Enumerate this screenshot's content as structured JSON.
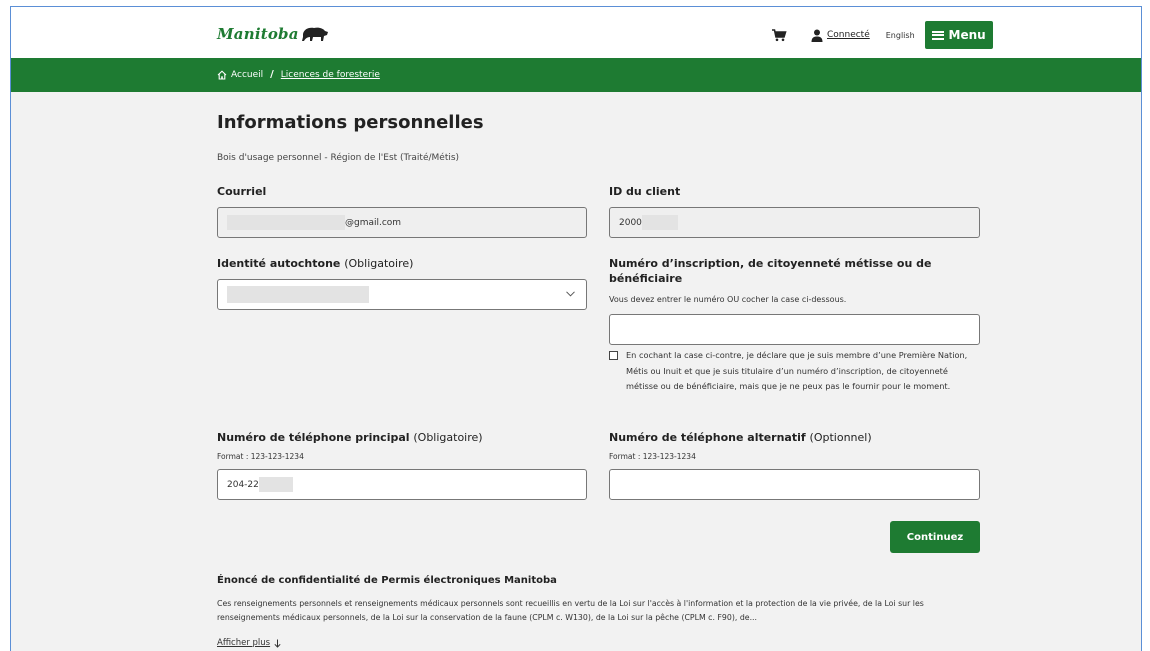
{
  "header": {
    "logo_text": "Manitoba",
    "connected_label": "Connecté",
    "language_label": "English",
    "menu_label": "Menu"
  },
  "breadcrumb": {
    "home_label": "Accueil",
    "separator": "/",
    "current_label": "Licences de foresterie"
  },
  "page": {
    "title": "Informations personnelles",
    "subtitle": "Bois d'usage personnel - Région de l'Est (Traité/Métis)"
  },
  "form": {
    "email": {
      "label": "Courriel",
      "value_suffix": "@gmail.com"
    },
    "client_id": {
      "label": "ID du client",
      "value_prefix": "2000"
    },
    "indigenous_identity": {
      "label": "Identité autochtone",
      "qualifier": "(Obligatoire)"
    },
    "registration_number": {
      "label": "Numéro d’inscription, de citoyenneté métisse ou de bénéficiaire",
      "hint": "Vous devez entrer le numéro OU cocher la case ci-dessous.",
      "value": ""
    },
    "declaration_checkbox": {
      "checked": false,
      "text": "En cochant la case ci-contre, je déclare que je suis membre d’une Première Nation, Métis ou Inuit et que je suis titulaire d’un numéro d’inscription, de citoyenneté métisse ou de bénéficiaire, mais que je ne peux pas le fournir pour le moment."
    },
    "primary_phone": {
      "label": "Numéro de téléphone principal",
      "qualifier": "(Obligatoire)",
      "format_hint": "Format : 123-123-1234",
      "value_prefix": "204-22"
    },
    "alternate_phone": {
      "label": "Numéro de téléphone alternatif",
      "qualifier": "(Optionnel)",
      "format_hint": "Format : 123-123-1234",
      "value": ""
    },
    "continue_label": "Continuez"
  },
  "privacy": {
    "title": "Énoncé de confidentialité de Permis électroniques Manitoba",
    "text": "Ces renseignements personnels et renseignements médicaux personnels sont recueillis en vertu de la Loi sur l'accès à l'information et la protection de la vie privée, de la Loi sur les renseignements médicaux personnels, de la Loi sur la conservation de la faune (CPLM c. W130), de la Loi sur la pêche (CPLM c. F90), de...",
    "show_more_label": "Afficher plus"
  },
  "colors": {
    "brand_green": "#1e7b32",
    "page_background": "#f2f2f2"
  },
  "icons": [
    "bison-logo-icon",
    "cart-icon",
    "user-icon",
    "hamburger-icon",
    "home-icon",
    "chevron-down-icon",
    "arrow-down-icon"
  ]
}
